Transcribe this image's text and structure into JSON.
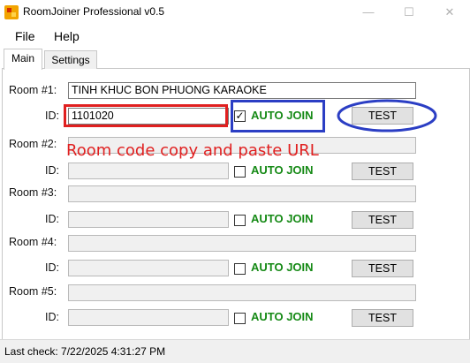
{
  "window": {
    "title": "RoomJoiner Professional v0.5",
    "controls": {
      "minimize": "—",
      "maximize": "☐",
      "close": "✕"
    },
    "icon": "app-icon"
  },
  "menu": {
    "file": "File",
    "help": "Help"
  },
  "tabs": {
    "main": "Main",
    "settings": "Settings"
  },
  "rooms": [
    {
      "label": "Room #1:",
      "name_value": "TINH KHUC BON PHUONG KARAOKE",
      "id_label": "ID:",
      "id_value": "1101020",
      "auto_join_label": "AUTO JOIN",
      "auto_join_checked": true,
      "checkbox_mark": "✓",
      "test_label": "TEST"
    },
    {
      "label": "Room #2:",
      "name_value": "",
      "id_label": "ID:",
      "id_value": "",
      "auto_join_label": "AUTO JOIN",
      "auto_join_checked": false,
      "test_label": "TEST"
    },
    {
      "label": "Room #3:",
      "name_value": "",
      "id_label": "ID:",
      "id_value": "",
      "auto_join_label": "AUTO JOIN",
      "auto_join_checked": false,
      "test_label": "TEST"
    },
    {
      "label": "Room #4:",
      "name_value": "",
      "id_label": "ID:",
      "id_value": "",
      "auto_join_label": "AUTO JOIN",
      "auto_join_checked": false,
      "test_label": "TEST"
    },
    {
      "label": "Room #5:",
      "name_value": "",
      "id_label": "ID:",
      "id_value": "",
      "auto_join_label": "AUTO JOIN",
      "auto_join_checked": false,
      "test_label": "TEST"
    }
  ],
  "annotation": {
    "text": "Room code copy and paste URL",
    "colors": {
      "red": "#e02020",
      "blue": "#2b3ec4"
    }
  },
  "status": {
    "last_check": "Last check: 7/22/2025 4:31:27 PM"
  },
  "colors": {
    "auto_join": "#168a16"
  }
}
